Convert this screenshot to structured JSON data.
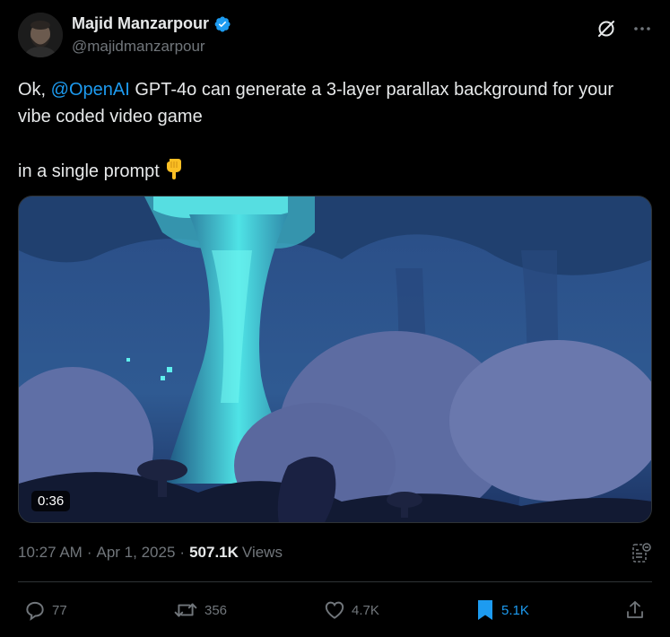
{
  "author": {
    "display_name": "Majid Manzarpour",
    "handle": "@majidmanzarpour",
    "verified": true,
    "avatar_icon": "avatar-photo"
  },
  "header_icons": {
    "grok": "grok-icon",
    "more": "more-icon"
  },
  "tweet": {
    "text_lead": "Ok, ",
    "mention": "@OpenAI",
    "text_rest": " GPT-4o can generate a 3-layer parallax background for your vibe coded video game",
    "text_line2": "in a single prompt",
    "emoji": "pointing-down-emoji"
  },
  "media": {
    "type": "video",
    "duration": "0:36"
  },
  "meta": {
    "time": "10:27 AM",
    "date": "Apr 1, 2025",
    "views_count": "507.1K",
    "views_label": "Views",
    "dot": "·"
  },
  "actions": {
    "replies": "77",
    "reposts": "356",
    "likes": "4.7K",
    "bookmarks": "5.1K"
  },
  "colors": {
    "background": "#000000",
    "text": "#e7e9ea",
    "secondary": "#71767b",
    "accent": "#1d9bf0",
    "divider": "#2f3336"
  }
}
